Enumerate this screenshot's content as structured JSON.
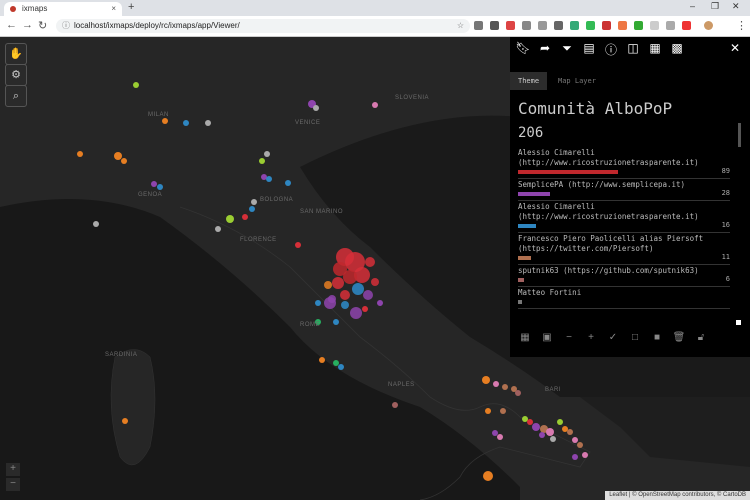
{
  "browser": {
    "tab_title": "ixmaps",
    "tab_close": "×",
    "new_tab": "+",
    "url": "localhost/ixmaps/deploy/rc/ixmaps/app/Viewer/",
    "back": "←",
    "forward": "→",
    "reload": "↻",
    "star": "☆",
    "lock": "ⓘ",
    "minimize": "–",
    "maximize": "❐",
    "close": "✕",
    "menu": "⋮"
  },
  "map": {
    "labels": {
      "slovenia": "SLOVENIA",
      "milan": "MILAN",
      "venice": "VENICE",
      "genoa": "GENOA",
      "bologna": "BOLOGNA",
      "florence": "FLORENCE",
      "san_marino": "SAN MARINO",
      "rome": "ROME",
      "naples": "NAPLES",
      "bari": "BARI",
      "sardinia": "SARDINIA"
    },
    "zoom_in": "+",
    "zoom_out": "−",
    "attribution": "Leaflet | © OpenStreetMap contributors, © CartoDB"
  },
  "panel": {
    "tabs": [
      {
        "label": "Theme"
      },
      {
        "label": "Map Layer"
      }
    ],
    "title": "Comunità AlboPoP",
    "total": "206",
    "items": [
      {
        "name": "Alessio Cimarelli (http://www.ricostruzionetrasparente.it)",
        "count": "89",
        "color": "#c0282d",
        "fraction": 0.47
      },
      {
        "name": "SemplicePA (http://www.semplicepa.it)",
        "count": "28",
        "color": "#8e44ad",
        "fraction": 0.15
      },
      {
        "name": "Alessio Cimarelli (http://www.ricostruzionetrasparente.it)",
        "count": "16",
        "color": "#2e86c1",
        "fraction": 0.085
      },
      {
        "name": "Francesco Piero Paolicelli alias Piersoft (https://twitter.com/Piersoft)",
        "count": "11",
        "color": "#b0704f",
        "fraction": 0.06
      },
      {
        "name": "sputnik63 (https://github.com/sputnik63)",
        "count": "6",
        "color": "#a0605f",
        "fraction": 0.03
      },
      {
        "name": "Matteo Fortini",
        "count": "",
        "color": "#777",
        "fraction": 0.02
      }
    ]
  }
}
